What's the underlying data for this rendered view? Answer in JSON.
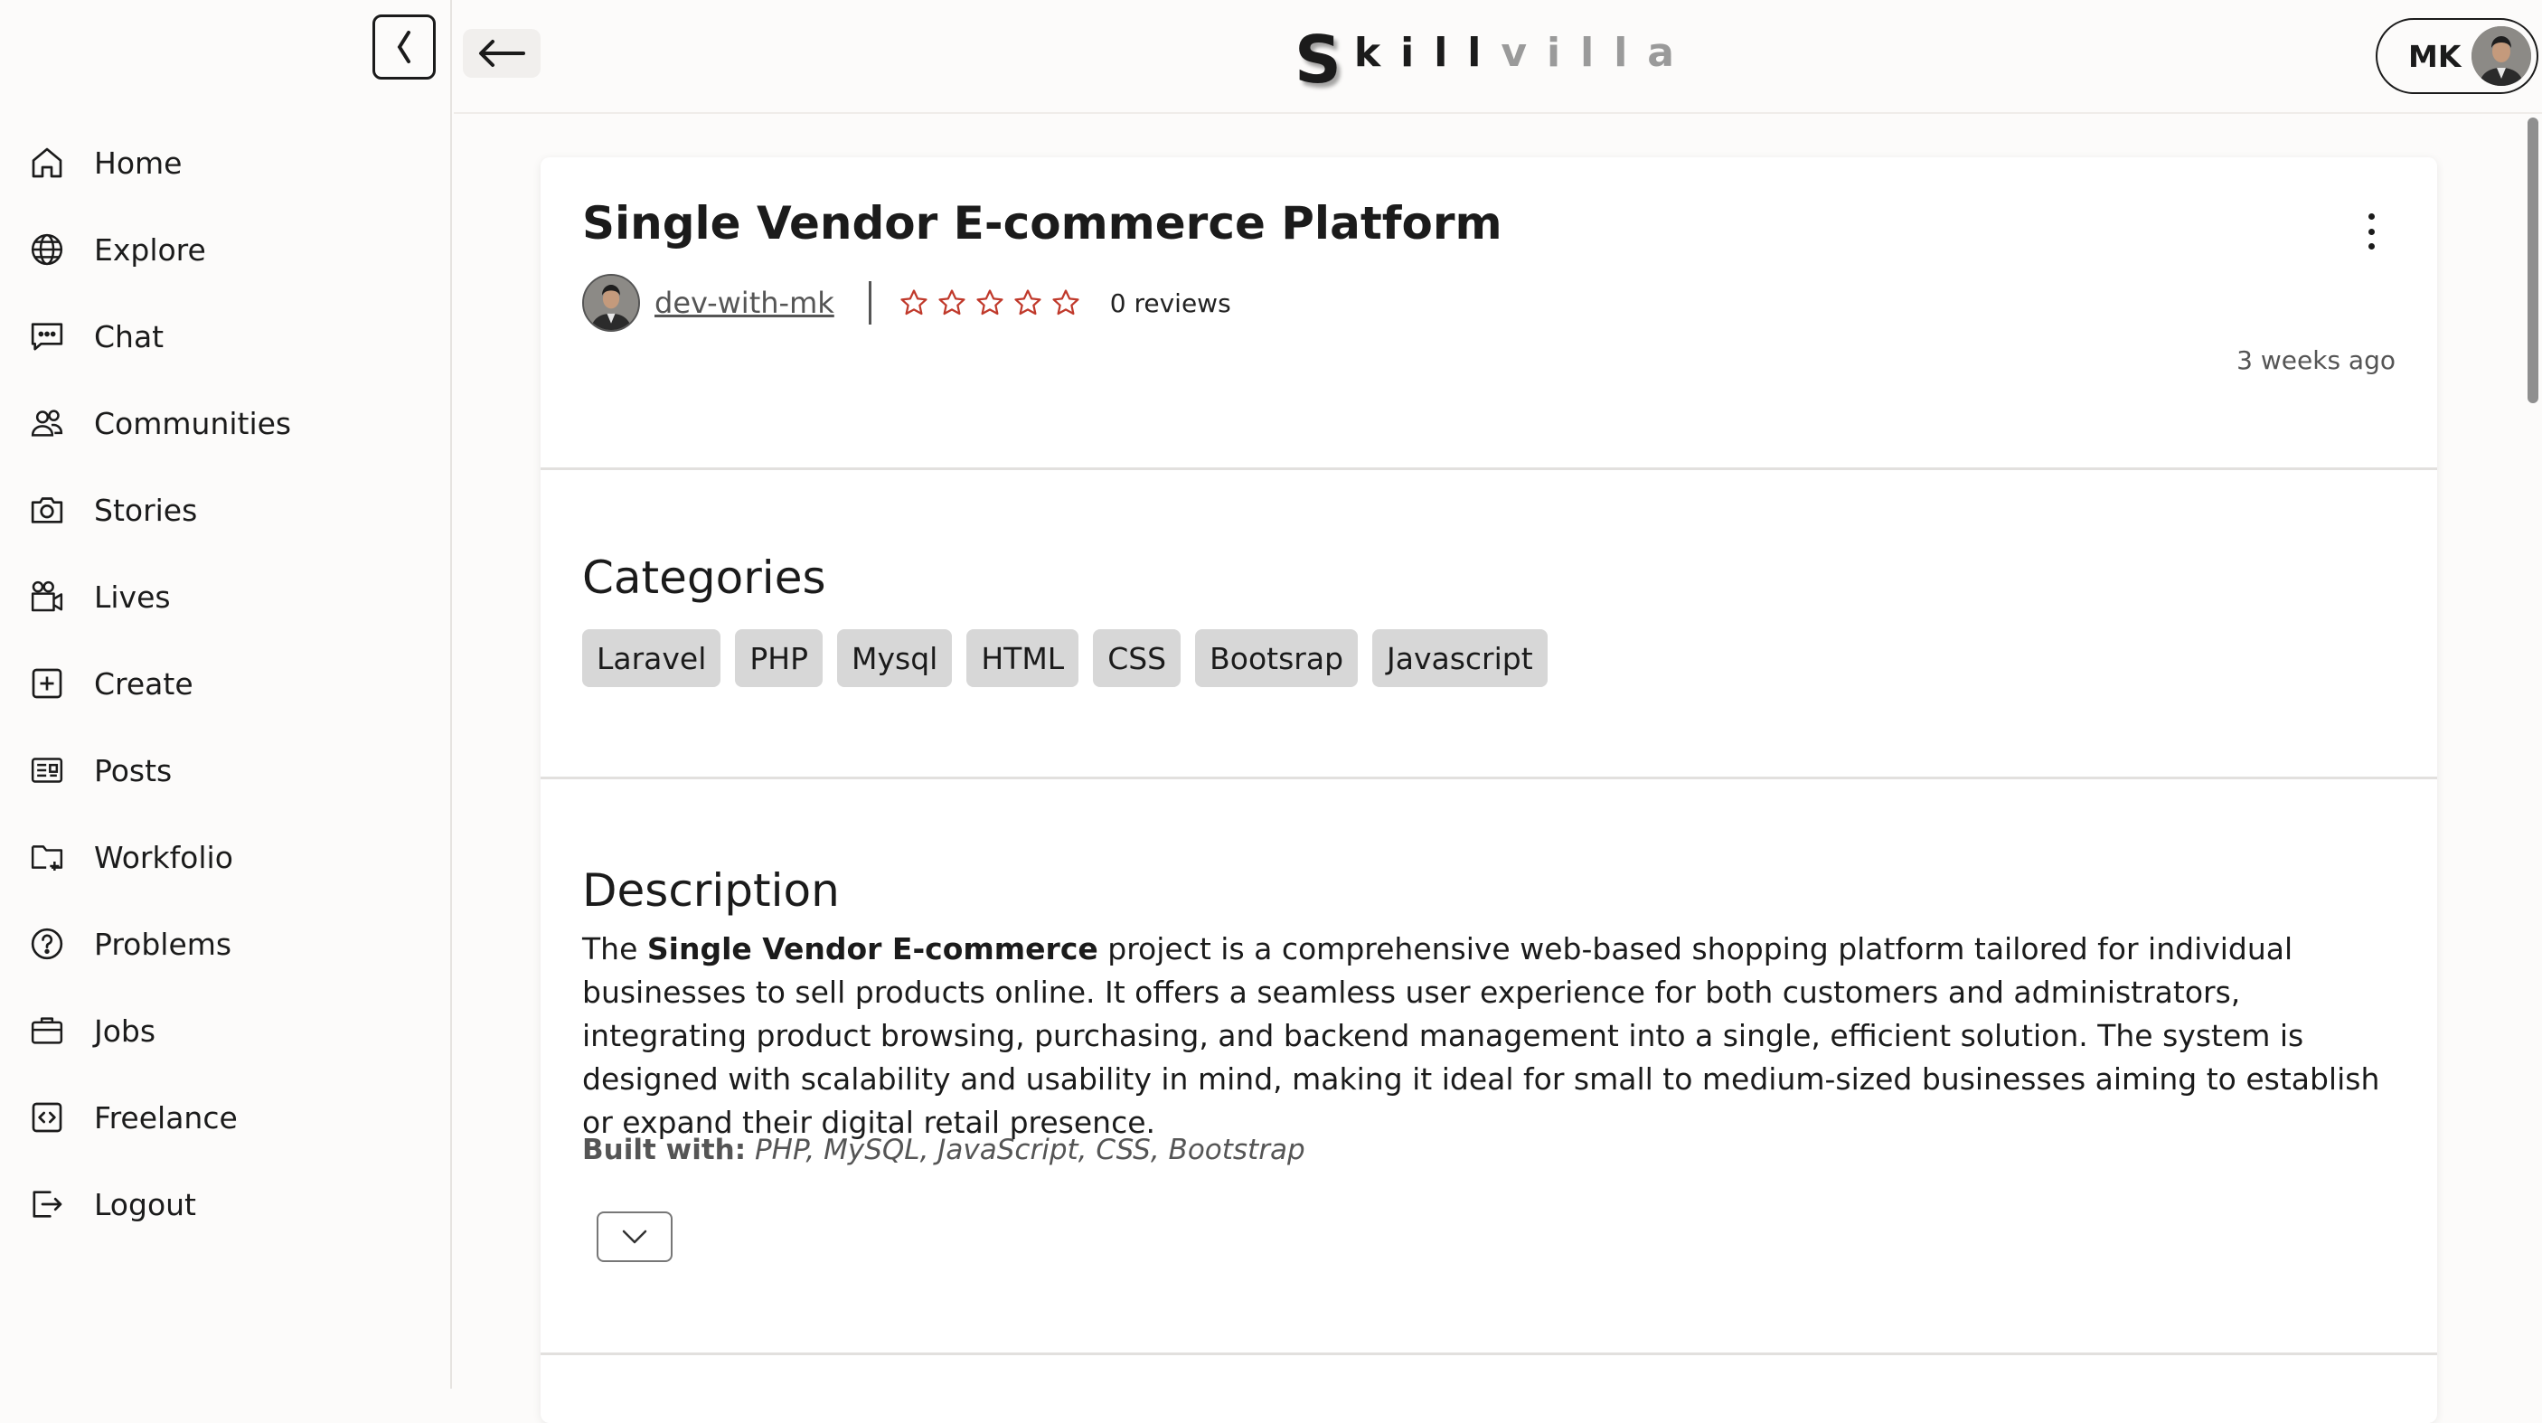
{
  "sidebar": {
    "items": [
      {
        "label": "Home",
        "icon": "home-icon"
      },
      {
        "label": "Explore",
        "icon": "globe-icon"
      },
      {
        "label": "Chat",
        "icon": "chat-icon"
      },
      {
        "label": "Communities",
        "icon": "users-icon"
      },
      {
        "label": "Stories",
        "icon": "camera-icon"
      },
      {
        "label": "Lives",
        "icon": "video-icon"
      },
      {
        "label": "Create",
        "icon": "plus-square-icon"
      },
      {
        "label": "Posts",
        "icon": "newspaper-icon"
      },
      {
        "label": "Workfolio",
        "icon": "folder-plus-icon"
      },
      {
        "label": "Problems",
        "icon": "help-circle-icon"
      },
      {
        "label": "Jobs",
        "icon": "briefcase-icon"
      },
      {
        "label": "Freelance",
        "icon": "code-square-icon"
      },
      {
        "label": "Logout",
        "icon": "logout-icon"
      }
    ]
  },
  "header": {
    "logo_s": "S",
    "logo_dark": "kill",
    "logo_light": "villa",
    "profile_initials": "MK"
  },
  "project": {
    "title": "Single Vendor E-commerce Platform",
    "author": "dev-with-mk",
    "rating_stars": 0,
    "rating_max": 5,
    "reviews": "0 reviews",
    "posted": "3 weeks ago"
  },
  "categories": {
    "heading": "Categories",
    "tags": [
      "Laravel",
      "PHP",
      "Mysql",
      "HTML",
      "CSS",
      "Bootsrap",
      "Javascript"
    ]
  },
  "description": {
    "heading": "Description",
    "intro": "The ",
    "bold": "Single Vendor E-commerce",
    "body": " project is a comprehensive web-based shopping platform tailored for individual businesses to sell products online. It offers a seamless user experience for both customers and administrators, integrating product browsing, purchasing, and backend management into a single, efficient solution. The system is designed with scalability and usability in mind, making it ideal for small to medium-sized businesses aiming to establish or expand their digital retail presence.",
    "built_label": "Built with:",
    "built_value": "PHP, MySQL, JavaScript, CSS, Bootstrap"
  },
  "colors": {
    "star_outline": "#c0392b",
    "tag_bg": "#d7d7d7",
    "background": "#fcfbfa"
  }
}
